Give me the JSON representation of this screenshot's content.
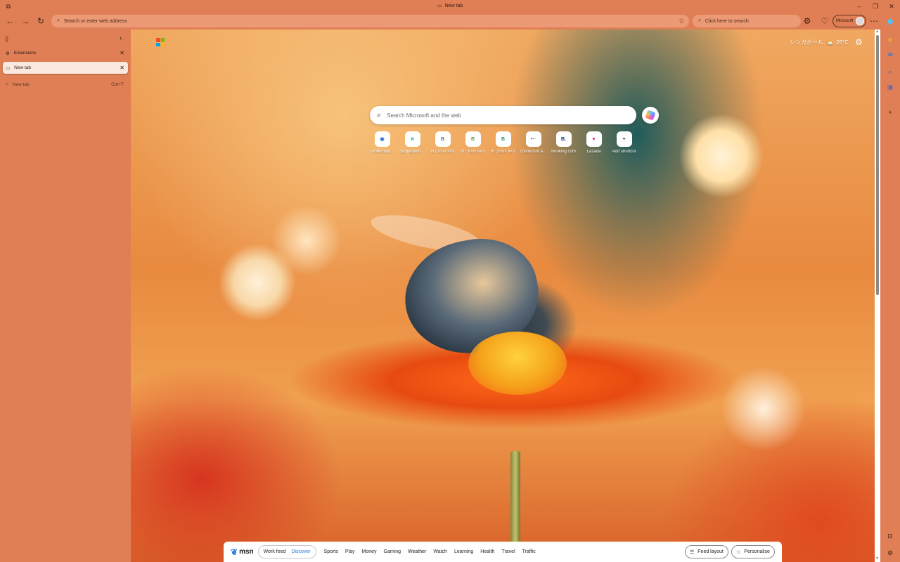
{
  "window": {
    "title": "New tab"
  },
  "toolbar": {
    "address_placeholder": "Search or enter web address",
    "search_placeholder": "Click here to search",
    "profile_label": "Microsoft"
  },
  "vtabs": {
    "items": [
      {
        "label": "Extensions"
      },
      {
        "label": "New tab"
      }
    ],
    "new_tab_label": "New tab",
    "new_tab_shortcut": "Ctrl+T"
  },
  "newtab": {
    "weather_location": "シンガポール",
    "weather_temp": "26°C",
    "search_placeholder": "Search Microsoft and the web",
    "shortcuts": [
      {
        "label": "productspl...",
        "glyph": "◉",
        "color": "#2a6fdb"
      },
      {
        "label": "Suggestion ...",
        "glyph": "✕",
        "color": "#1b8fd6"
      },
      {
        "label": "th (300×300)",
        "glyph": "B",
        "color": "#5b6b8a"
      },
      {
        "label": "th (300×300)",
        "glyph": "B",
        "color": "#5aa12b"
      },
      {
        "label": "th (300×300)",
        "glyph": "B",
        "color": "#2f8a6a"
      },
      {
        "label": "cosmos08 A...",
        "glyph": "•··",
        "color": "#555555"
      },
      {
        "label": "Booking.com",
        "glyph": "B.",
        "color": "#003580"
      },
      {
        "label": "Lazada",
        "glyph": "♥",
        "color": "#f0146e"
      },
      {
        "label": "Add shortcut",
        "glyph": "+",
        "color": "#333333"
      }
    ]
  },
  "feed": {
    "brand": "msn",
    "tabs": [
      "Work feed",
      "Discover"
    ],
    "active_tab": "Discover",
    "nav": [
      "Sports",
      "Play",
      "Money",
      "Gaming",
      "Weather",
      "Watch",
      "Learning",
      "Health",
      "Travel",
      "Traffic"
    ],
    "feed_layout_label": "Feed layout",
    "personalise_label": "Personalise"
  },
  "colors": {
    "frame": "#e07f55",
    "active_tab_bg": "#fbe9df",
    "link": "#2a7de1"
  }
}
